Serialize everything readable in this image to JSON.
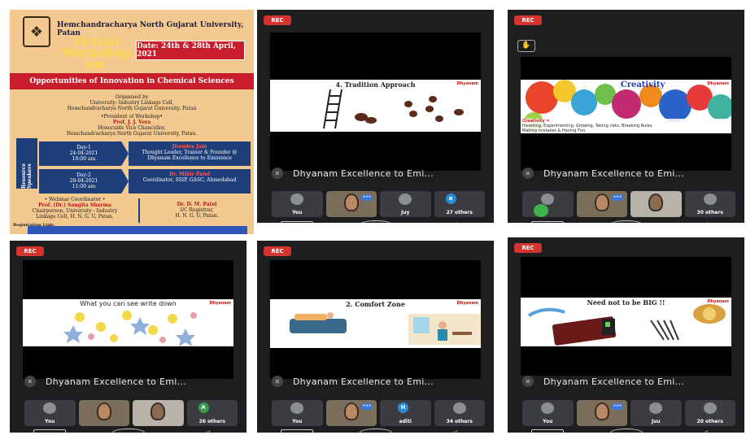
{
  "poster": {
    "university": "Hemchandracharya North Gujarat University, Patan",
    "virtual_line1": "Virtual",
    "virtual_line2": "Workshop",
    "virtual_line3": "on",
    "date": "Date: 24th & 28th April, 2021",
    "topic": "Opportunities of Innovation in Chemical Sciences",
    "organised_by": "Organised by",
    "organiser": "University- Industry Linkage Cell,",
    "organiser_univ": "Hemchandracharya North Gujarat University, Patan",
    "president_heading": "•President of Workshop•",
    "president_name": "Prof. J. J. Vora",
    "president_role": "Honorable Vice Chancellor,",
    "president_univ": "Hemchandracharya North Gujarat University, Patan.",
    "side_label": "Resource Speakers",
    "day1_label": "Day-1",
    "day1_date": "24-04-2021",
    "day1_time": "10:00 am",
    "day1_speaker": "Jitendra Jain",
    "day1_desc": "Thought Leader, Trainer & Founder @ Dhyanam Excellence to Eminence",
    "day2_label": "Day-2",
    "day2_date": "28-04-2021",
    "day2_time": "11:00 am",
    "day2_speaker": "Dr. Mihir Patel",
    "day2_desc": "Coordinator, SSIP, GASC, Ahmedabad",
    "coord_heading": "• Webinar Coordinator •",
    "coord_name": "Prof. (Dr.) Sangita Sharma",
    "coord_role": "Chairperson, University - Industry",
    "coord_role2": "Linkage Cell, H. N. G. U, Patan.",
    "reg_name": "Dr. D. M. Patel",
    "reg_role": "I/C Registrar,",
    "reg_univ": "H. N. G. U, Patan.",
    "registration": "Registration Link:"
  },
  "tiles": [
    {
      "rec": "REC",
      "slide_title": "4. Tradition Approach",
      "slide_logo": "Dhyanam",
      "caption": "Dhyanam Excellence to Emi...",
      "participants": [
        "You",
        "",
        "Juy",
        "27 others"
      ],
      "nav": [
        "□",
        "○",
        "◁"
      ]
    },
    {
      "rec": "REC",
      "slide_title": "Creativity",
      "slide_logo": "Dhyanam",
      "slide_body1": "Creativity =",
      "slide_body2": "Investing, Experimenting, Growing, Taking risks, Breaking Rules,",
      "slide_body3": "Making mistakes & Having Fun.",
      "caption": "Dhyanam Excellence to Emi...",
      "participants": [
        "",
        "",
        "",
        "30 others"
      ],
      "nav": [
        "□",
        "○",
        "◁"
      ]
    },
    {
      "rec": "REC",
      "slide_title": "What you can see write down",
      "slide_logo": "Dhyanam",
      "caption": "Dhyanam Excellence to Emi...",
      "participants": [
        "You",
        "",
        "",
        "26 others"
      ],
      "avatar_letter": "A",
      "nav": [
        "□",
        "○",
        "◁"
      ]
    },
    {
      "rec": "REC",
      "slide_title": "2. Comfort Zone",
      "slide_logo": "Dhyanam",
      "caption": "Dhyanam Excellence to Emi...",
      "participants": [
        "You",
        "",
        "aditi",
        "34 others"
      ],
      "avatar_letter": "H",
      "nav": [
        "□",
        "○",
        "◁"
      ]
    },
    {
      "rec": "REC",
      "slide_title": "Need not to be BIG !!",
      "slide_logo": "Dhyanam",
      "caption": "Dhyanam Excellence to Emi...",
      "participants": [
        "You",
        "",
        "Juu",
        "20 others"
      ],
      "nav": [
        "□",
        "○",
        "◁"
      ]
    }
  ],
  "colors": {
    "poster_bg": "#f4c98f",
    "accent_red": "#c81d2a",
    "navy": "#1f3f7a",
    "rec": "#d5332f",
    "tile_bg": "#1e1e20"
  }
}
